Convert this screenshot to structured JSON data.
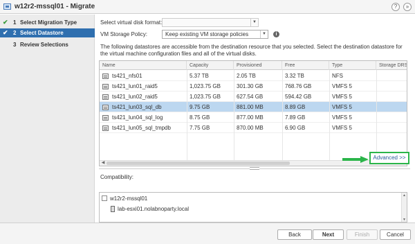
{
  "window": {
    "title": "w12r2-mssql01 - Migrate",
    "help_glyph": "?",
    "expand_glyph": "»"
  },
  "steps": [
    {
      "num": "1",
      "label": "Select Migration Type",
      "done": true,
      "active": false
    },
    {
      "num": "2",
      "label": "Select Datastore",
      "done": true,
      "active": true
    },
    {
      "num": "3",
      "label": "Review Selections",
      "done": false,
      "active": false
    }
  ],
  "form": {
    "disk_format_label": "Select virtual disk format:",
    "disk_format_value": "",
    "storage_policy_label": "VM Storage Policy:",
    "storage_policy_value": "Keep existing VM storage policies",
    "description": "The following datastores are accessible from the destination resource that you selected. Select the destination datastore for the virtual machine configuration files and all of the virtual disks."
  },
  "datastore_table": {
    "columns": [
      "Name",
      "Capacity",
      "Provisioned",
      "Free",
      "Type",
      "Storage DRS"
    ],
    "rows": [
      {
        "name": "ts421_nfs01",
        "capacity": "5.37 TB",
        "provisioned": "2.05 TB",
        "free": "3.32 TB",
        "type": "NFS",
        "selected": false
      },
      {
        "name": "ts421_lun01_raid5",
        "capacity": "1,023.75 GB",
        "provisioned": "301.30 GB",
        "free": "768.76 GB",
        "type": "VMFS 5",
        "selected": false
      },
      {
        "name": "ts421_lun02_raid5",
        "capacity": "1,023.75 GB",
        "provisioned": "627.54 GB",
        "free": "594.42 GB",
        "type": "VMFS 5",
        "selected": false
      },
      {
        "name": "ts421_lun03_sql_db",
        "capacity": "9.75 GB",
        "provisioned": "881.00 MB",
        "free": "8.89 GB",
        "type": "VMFS 5",
        "selected": true
      },
      {
        "name": "ts421_lun04_sql_log",
        "capacity": "8.75 GB",
        "provisioned": "877.00 MB",
        "free": "7.89 GB",
        "type": "VMFS 5",
        "selected": false
      },
      {
        "name": "ts421_lun05_sql_tmpdb",
        "capacity": "7.75 GB",
        "provisioned": "870.00 MB",
        "free": "6.90 GB",
        "type": "VMFS 5",
        "selected": false
      }
    ]
  },
  "advanced_button": "Advanced >>",
  "compatibility": {
    "label": "Compatibility:",
    "vm_name": "w12r2-mssql01",
    "host_name": "lab-esxi01.nolabnoparty.local"
  },
  "footer": {
    "back": "Back",
    "next": "Next",
    "finish": "Finish",
    "cancel": "Cancel"
  },
  "colors": {
    "accent": "#2f6faf",
    "selected_row": "#bcd7f0",
    "highlight_green": "#2bb54a"
  }
}
